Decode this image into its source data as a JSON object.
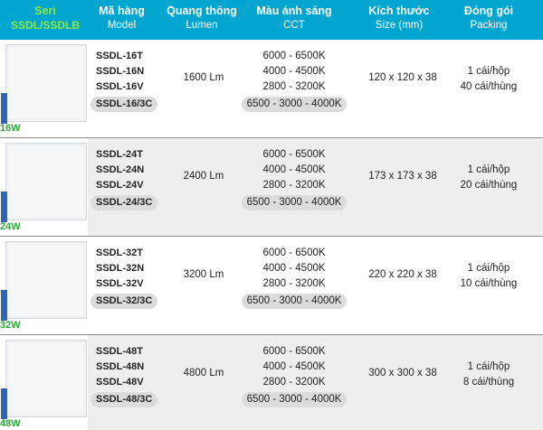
{
  "header": {
    "seri_label": "Seri",
    "seri_value": "SSDL/SSDLB",
    "model": {
      "title": "Mã hàng",
      "sub": "Model"
    },
    "lumen": {
      "title": "Quang thông",
      "sub": "Lumen"
    },
    "cct": {
      "title": "Màu ánh sáng",
      "sub": "CCT"
    },
    "size": {
      "title": "Kích thước",
      "sub": "Size (mm)"
    },
    "packing": {
      "title": "Đóng gói",
      "sub": "Packing"
    }
  },
  "colors": {
    "header_bg": "#00a6cf",
    "seri_green": "#8fe83a",
    "watt_green": "#2da637",
    "row_alt_bg": "#eeeeee",
    "pill_bg": "#dcdcdc"
  },
  "rows": [
    {
      "watt": "16W",
      "models": [
        "SSDL-16T",
        "SSDL-16N",
        "SSDL-16V",
        "SSDL-16/3C"
      ],
      "lumen": "1600 Lm",
      "cct": [
        "6000 - 6500K",
        "4000 - 4500K",
        "2800 - 3200K",
        "6500 - 3000 - 4000K"
      ],
      "size": "120 x 120 x 38",
      "packing": [
        "1 cái/hộp",
        "40 cái/thùng"
      ]
    },
    {
      "watt": "24W",
      "models": [
        "SSDL-24T",
        "SSDL-24N",
        "SSDL-24V",
        "SSDL-24/3C"
      ],
      "lumen": "2400 Lm",
      "cct": [
        "6000 - 6500K",
        "4000 - 4500K",
        "2800 - 3200K",
        "6500 - 3000 - 4000K"
      ],
      "size": "173 x 173 x 38",
      "packing": [
        "1 cái/hộp",
        "20 cái/thùng"
      ]
    },
    {
      "watt": "32W",
      "models": [
        "SSDL-32T",
        "SSDL-32N",
        "SSDL-32V",
        "SSDL-32/3C"
      ],
      "lumen": "3200 Lm",
      "cct": [
        "6000 - 6500K",
        "4000 - 4500K",
        "2800 - 3200K",
        "6500 - 3000 - 4000K"
      ],
      "size": "220 x 220 x 38",
      "packing": [
        "1 cái/hộp",
        "10 cái/thùng"
      ]
    },
    {
      "watt": "48W",
      "models": [
        "SSDL-48T",
        "SSDL-48N",
        "SSDL-48V",
        "SSDL-48/3C"
      ],
      "lumen": "4800 Lm",
      "cct": [
        "6000 - 6500K",
        "4000 - 4500K",
        "2800 - 3200K",
        "6500 - 3000 - 4000K"
      ],
      "size": "300 x 300 x 38",
      "packing": [
        "1 cái/hộp",
        "8 cái/thùng"
      ]
    }
  ]
}
